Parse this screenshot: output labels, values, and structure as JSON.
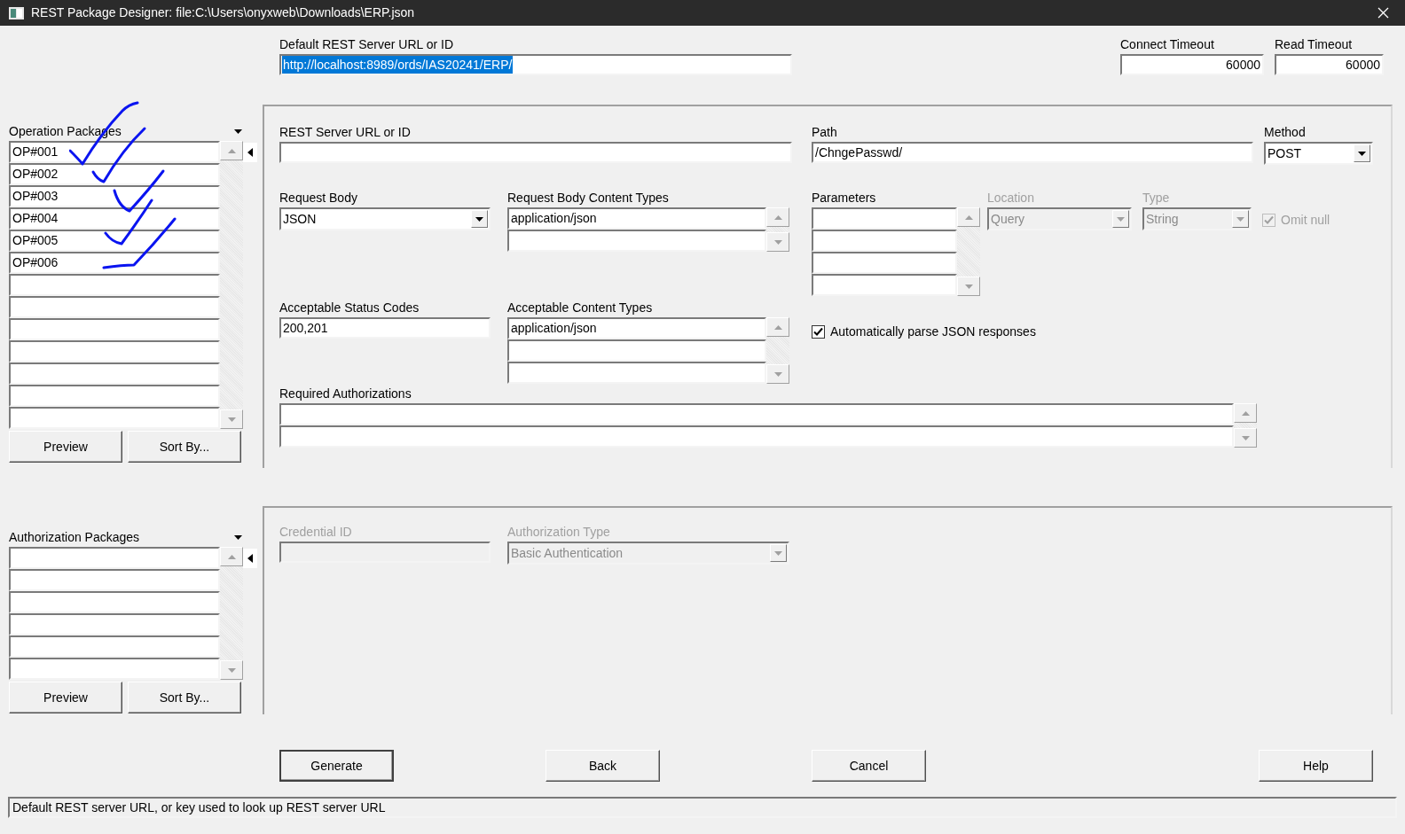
{
  "window": {
    "title": "REST Package Designer: file:C:\\Users\\onyxweb\\Downloads\\ERP.json"
  },
  "default_server": {
    "label": "Default REST Server URL or ID",
    "value": "http://localhost:8989/ords/IAS20241/ERP/",
    "selected": true
  },
  "connect_timeout": {
    "label": "Connect Timeout",
    "value": "60000"
  },
  "read_timeout": {
    "label": "Read Timeout",
    "value": "60000"
  },
  "operation_packages": {
    "label": "Operation Packages",
    "items": [
      "OP#001",
      "OP#002",
      "OP#003",
      "OP#004",
      "OP#005",
      "OP#006"
    ],
    "buttons": [
      "Preview",
      "Sort By..."
    ]
  },
  "operation": {
    "rest_server_url": {
      "label": "REST Server URL or ID"
    },
    "path": {
      "label": "Path",
      "value": "/ChngePasswd/"
    },
    "method": {
      "label": "Method",
      "value": "POST"
    },
    "request_body": {
      "label": "Request Body",
      "value": "JSON"
    },
    "request_body_content_types": {
      "label": "Request Body Content Types",
      "items": [
        "application/json"
      ]
    },
    "parameters": {
      "label": "Parameters"
    },
    "location": {
      "label": "Location",
      "value": "Query",
      "disabled": true
    },
    "type": {
      "label": "Type",
      "value": "String",
      "disabled": true
    },
    "omit_null": {
      "label": "Omit null",
      "checked": true,
      "disabled": true
    },
    "acceptable_status_codes": {
      "label": "Acceptable Status Codes",
      "value": "200,201"
    },
    "acceptable_content_types": {
      "label": "Acceptable Content Types",
      "items": [
        "application/json"
      ]
    },
    "auto_parse": {
      "label": "Automatically parse JSON responses",
      "checked": true,
      "disabled": false
    },
    "required_authorizations": {
      "label": "Required Authorizations"
    }
  },
  "authorization_packages": {
    "label": "Authorization Packages",
    "buttons": [
      "Preview",
      "Sort By..."
    ]
  },
  "authorization": {
    "credential_id": {
      "label": "Credential ID",
      "disabled": true
    },
    "authorization_type": {
      "label": "Authorization Type",
      "value": "Basic Authentication",
      "disabled": true
    }
  },
  "actions": [
    {
      "label": "Generate",
      "default": true
    },
    {
      "label": "Back",
      "default": false
    },
    {
      "label": "Cancel",
      "default": false
    },
    {
      "label": "Help",
      "default": false
    }
  ],
  "status_bar": "Default REST server URL, or key used to look up REST server URL"
}
